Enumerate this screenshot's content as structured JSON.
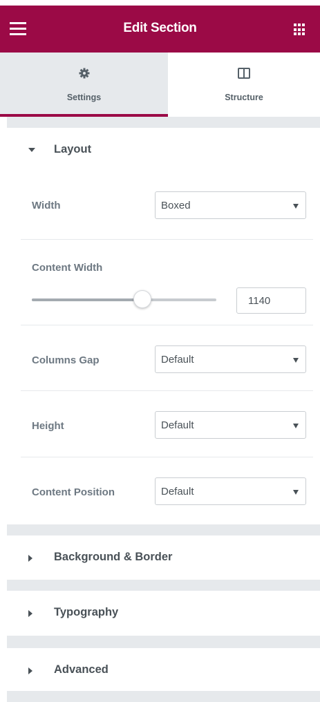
{
  "header": {
    "title": "Edit Section",
    "menu_icon": "hamburger-menu-icon",
    "apps_icon": "grid-apps-icon",
    "bg_color": "#9b0a46"
  },
  "tabs": [
    {
      "label": "Settings",
      "icon": "gear-icon",
      "active": true
    },
    {
      "label": "Structure",
      "icon": "columns-icon",
      "active": false
    }
  ],
  "layout": {
    "title": "Layout",
    "expanded": true,
    "width": {
      "label": "Width",
      "value": "Boxed"
    },
    "content_width": {
      "label": "Content Width",
      "value": "1140",
      "slider_fraction": 0.6
    },
    "columns_gap": {
      "label": "Columns Gap",
      "value": "Default"
    },
    "height": {
      "label": "Height",
      "value": "Default"
    },
    "content_position": {
      "label": "Content Position",
      "value": "Default"
    }
  },
  "sections": [
    {
      "title": "Background & Border",
      "expanded": false
    },
    {
      "title": "Typography",
      "expanded": false
    },
    {
      "title": "Advanced",
      "expanded": false
    }
  ]
}
